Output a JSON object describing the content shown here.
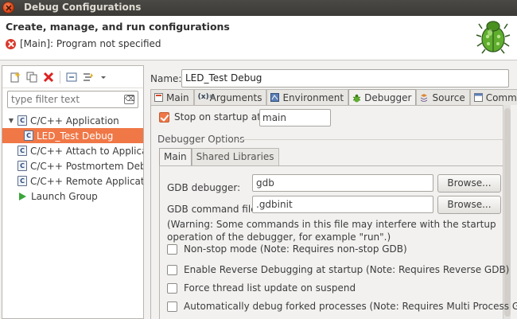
{
  "window": {
    "title": "Debug Configurations"
  },
  "header": {
    "title": "Create, manage, and run configurations",
    "message": "[Main]: Program not specified"
  },
  "filter": {
    "placeholder": "type filter text"
  },
  "tree": [
    {
      "label": "C/C++ Application",
      "expanded": true,
      "level": 0,
      "icon": "c-app-icon"
    },
    {
      "label": "LED_Test Debug",
      "level": 1,
      "selected": true,
      "icon": "c-config-icon"
    },
    {
      "label": "C/C++ Attach to Applicati",
      "level": 0,
      "icon": "c-attach-icon"
    },
    {
      "label": "C/C++ Postmortem Debug",
      "level": 0,
      "icon": "c-postmortem-icon"
    },
    {
      "label": "C/C++ Remote Application",
      "level": 0,
      "icon": "c-remote-icon"
    },
    {
      "label": "Launch Group",
      "level": 0,
      "icon": "launch-group-icon"
    }
  ],
  "name": {
    "label": "Name:",
    "value": "LED_Test Debug"
  },
  "tabs": [
    {
      "label": "Main"
    },
    {
      "label": "Arguments"
    },
    {
      "label": "Environment"
    },
    {
      "label": "Debugger",
      "active": true
    },
    {
      "label": "Source"
    },
    {
      "label": "Common"
    }
  ],
  "debugger": {
    "stop_label": "Stop on startup at:",
    "stop_checked": true,
    "stop_value": "main",
    "group_title": "Debugger Options",
    "subtabs": [
      {
        "label": "Main",
        "active": true
      },
      {
        "label": "Shared Libraries"
      }
    ],
    "gdb_label": "GDB debugger:",
    "gdb_value": "gdb",
    "cmd_label": "GDB command file:",
    "cmd_value": ".gdbinit",
    "browse_label": "Browse...",
    "warning": "(Warning: Some commands in this file may interfere with the startup operation of the debugger, for example \"run\".)",
    "options": [
      {
        "label": "Non-stop mode (Note: Requires non-stop GDB)",
        "checked": false
      },
      {
        "label": "Enable Reverse Debugging at startup (Note: Requires Reverse GDB)",
        "checked": false
      },
      {
        "label": "Force thread list update on suspend",
        "checked": false
      },
      {
        "label": "Automatically debug forked processes (Note: Requires Multi Process GDB)",
        "checked": false
      }
    ]
  },
  "colors": {
    "accent": "#f07746",
    "titlebar": "#3c3b37"
  }
}
